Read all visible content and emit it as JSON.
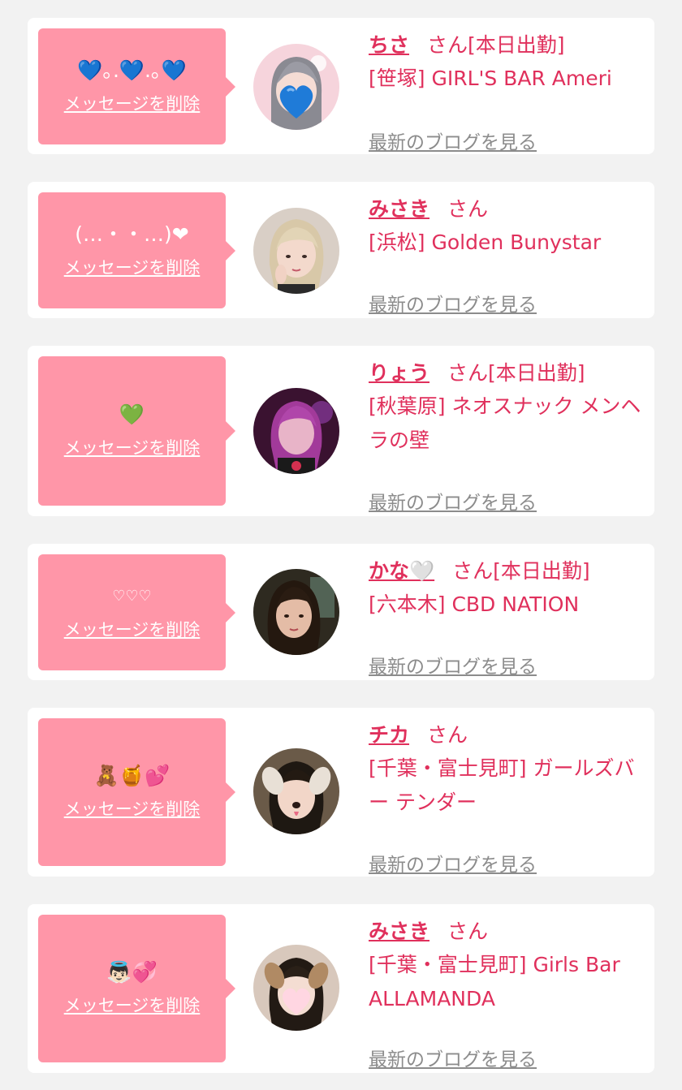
{
  "delete_label": "メッセージを削除",
  "blog_label": "最新のブログを見る",
  "colors": {
    "background": "#f2f2f2",
    "bubble": "#ff96a8",
    "accent": "#e0305c",
    "link_gray": "#8c8c8c"
  },
  "entries": [
    {
      "message": "💙｡.💙.｡💙",
      "name": "ちさ",
      "suffix": "さん[本日出勤]",
      "shop": "[笹塚] GIRL'S BAR Ameri",
      "avatar_icon": "girl-with-heart-sticker-icon"
    },
    {
      "message": "(…・・…)❤",
      "name": "みさき",
      "suffix": "さん",
      "shop": "[浜松] Golden Bunystar",
      "avatar_icon": "blonde-girl-icon"
    },
    {
      "message": "💚",
      "name": "りょう",
      "suffix": "さん[本日出勤]",
      "shop": "[秋葉原] ネオスナック メンヘラの壁",
      "avatar_icon": "purple-hair-girl-icon"
    },
    {
      "message": "♡♡♡",
      "name": "かな🤍",
      "suffix": "さん[本日出勤]",
      "shop": "[六本木] CBD NATION",
      "avatar_icon": "dark-hair-girl-icon"
    },
    {
      "message": "🧸🍯💕",
      "name": "チカ",
      "suffix": "さん",
      "shop": "[千葉・富士見町] ガールズバー テンダー",
      "avatar_icon": "dog-filter-girl-icon"
    },
    {
      "message": "👼🏻💞",
      "name": "みさき",
      "suffix": "さん",
      "shop": "[千葉・富士見町] Girls Bar ALLAMANDA",
      "avatar_icon": "dog-filter-heart-girl-icon"
    }
  ]
}
